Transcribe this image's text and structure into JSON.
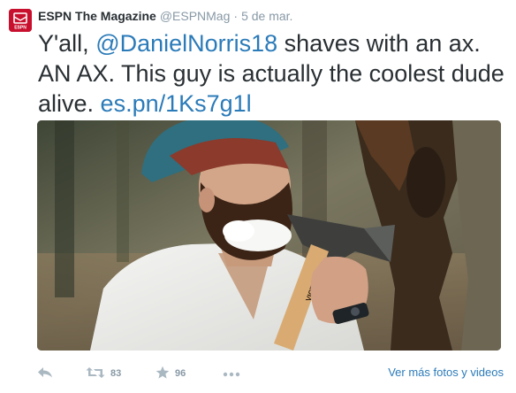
{
  "tweet": {
    "display_name": "ESPN The Magazine",
    "handle": "@ESPNMag",
    "separator": "·",
    "time": "5 de mar.",
    "avatar_text": "ESPN",
    "text_before": "Y'all, ",
    "mention": "@DanielNorris18",
    "text_middle": " shaves with an ax. AN AX. This guy is actually the coolest dude alive. ",
    "link": "es.pn/1Ks7g1l",
    "axe_brand": "VICTOR",
    "retweet_count": "83",
    "favorite_count": "96",
    "more_media_label": "Ver más fotos y videos"
  },
  "icons": {
    "reply": "reply-icon",
    "retweet": "retweet-icon",
    "favorite": "star-icon",
    "more": "more-dots-icon"
  },
  "colors": {
    "link": "#2b7bb9",
    "text": "#292f33",
    "muted": "#8899a6",
    "brand": "#c8102e"
  }
}
